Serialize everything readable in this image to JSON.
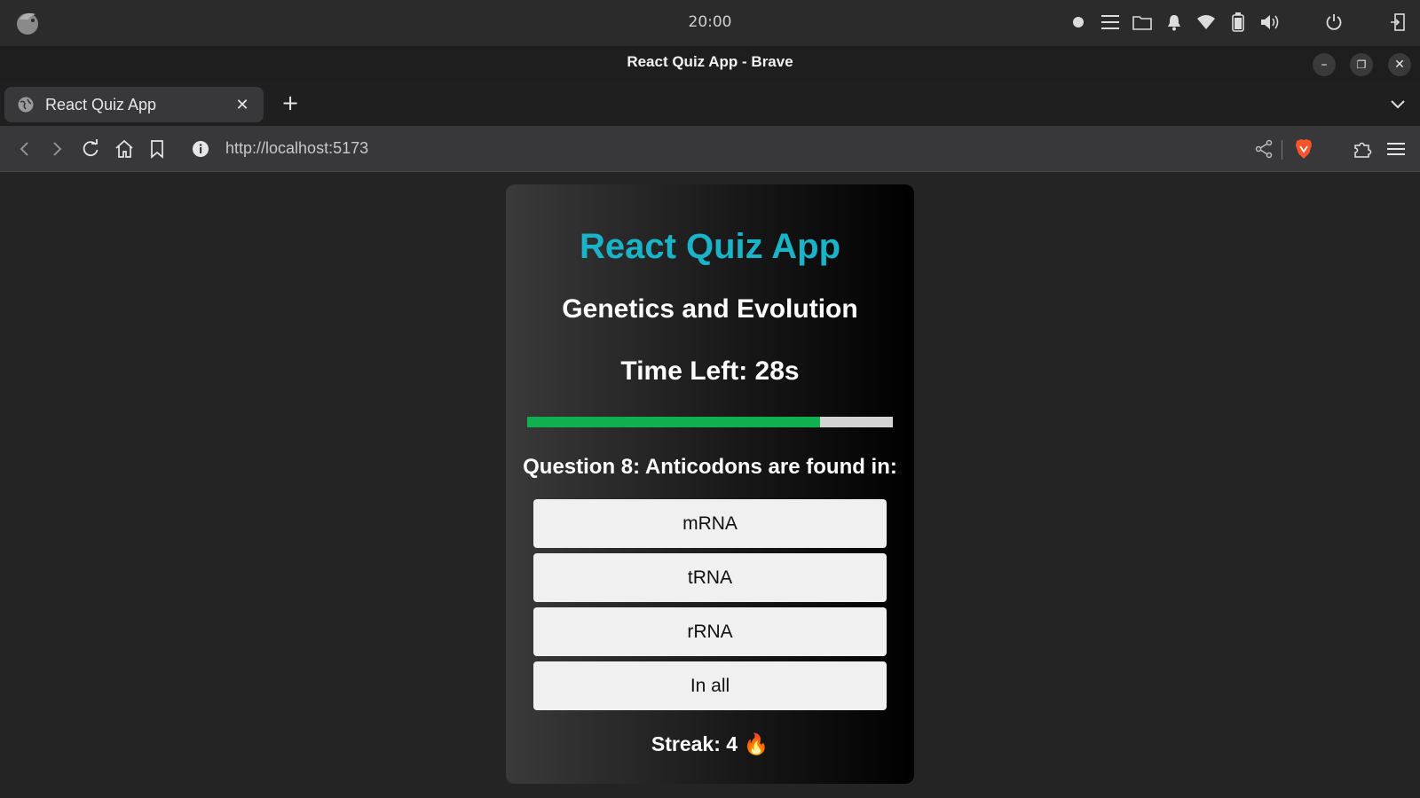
{
  "os": {
    "clock": "20:00",
    "tray_icons": [
      "record-dot-icon",
      "menu-lines-icon",
      "folder-icon",
      "bell-icon",
      "wifi-icon",
      "battery-icon",
      "volume-icon",
      "power-icon",
      "logout-icon"
    ]
  },
  "window": {
    "title": "React Quiz App - Brave",
    "minimize_glyph": "–",
    "restore_glyph": "❐",
    "close_glyph": "✕"
  },
  "browser": {
    "tab_label": "React Quiz App",
    "tab_close_glyph": "✕",
    "new_tab_glyph": "+",
    "url": "http://localhost:5173"
  },
  "quiz": {
    "app_title": "React Quiz App",
    "topic": "Genetics and Evolution",
    "timer_text": "Time Left: 28s",
    "time_remaining_fraction": 0.8,
    "question": "Question 8: Anticodons are found in:",
    "options": [
      "mRNA",
      "tRNA",
      "rRNA",
      "In all"
    ],
    "streak_text": "Streak: 4 🔥"
  },
  "colors": {
    "accent_title": "#1ab3c8",
    "progress_fill": "#10b050",
    "brave_orange": "#fb542b"
  }
}
